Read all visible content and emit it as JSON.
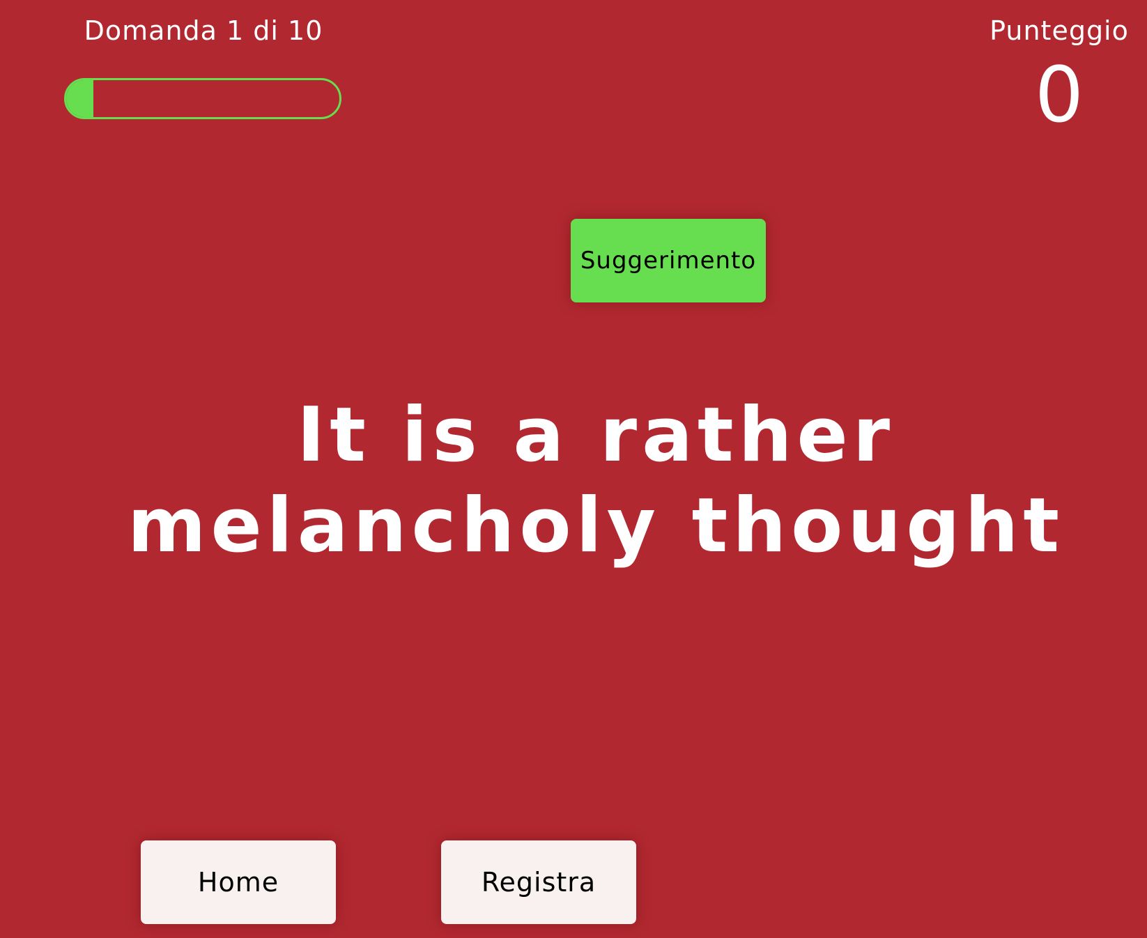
{
  "header": {
    "progress_label": "Domanda 1 di 10",
    "progress_value": 0.1,
    "score_label": "Punteggio",
    "score_value": "0"
  },
  "hint": {
    "label": "Suggerimento"
  },
  "question": {
    "text": "It is a rather melancholy thought"
  },
  "footer": {
    "home_label": "Home",
    "register_label": "Registra"
  },
  "colors": {
    "background": "#b12830",
    "accent": "#66de4f",
    "button_light": "#f8f1ef",
    "text": "#ffffff"
  }
}
